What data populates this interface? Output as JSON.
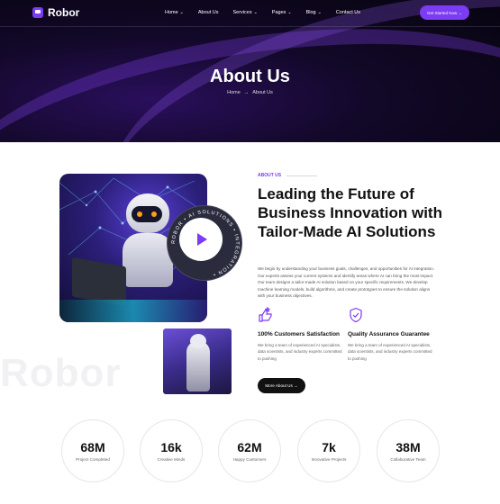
{
  "brand": {
    "name": "Robor",
    "accent": "#7b3cf3"
  },
  "nav": {
    "items": [
      {
        "label": "Home",
        "dropdown": true
      },
      {
        "label": "About Us",
        "dropdown": false
      },
      {
        "label": "Services",
        "dropdown": true
      },
      {
        "label": "Pages",
        "dropdown": true
      },
      {
        "label": "Blog",
        "dropdown": true
      },
      {
        "label": "Contact Us",
        "dropdown": false
      }
    ],
    "cta_label": "Get Started Now →"
  },
  "hero": {
    "title": "About Us",
    "breadcrumb": {
      "home": "Home",
      "separator": "→",
      "current": "About Us"
    }
  },
  "about": {
    "tag": "ABOUT US",
    "title": "Leading the Future of Business Innovation with Tailor-Made AI Solutions",
    "description": "We begin by understanding your business goals, challenges, and opportunities for AI integration. Our experts assess your current systems and identify areas where AI can bring the most impact. Our team designs a tailor-made AI solution based on your specific requirements. We develop machine learning models, build algorithms, and create prototypes to ensure the solution aligns with your business objectives.",
    "ring_text": "ROBOR • AI SOLUTIONS • INTEGRATION •",
    "watermark": "Robor",
    "features": [
      {
        "icon": "thumbs-up-icon",
        "title": "100% Customers Satisfaction",
        "desc": "We bring a team of experienced AI specialists, data scientists, and industry experts committed to pushing"
      },
      {
        "icon": "shield-check-icon",
        "title": "Quality Assurance Guarantee",
        "desc": "We bring a team of experienced AI specialists, data scientists, and industry experts committed to pushing"
      }
    ],
    "button_label": "More About Us →"
  },
  "stats": [
    {
      "value": "68M",
      "label": "Project Completed"
    },
    {
      "value": "16k",
      "label": "Creative Minds"
    },
    {
      "value": "62M",
      "label": "Happy Customers"
    },
    {
      "value": "7k",
      "label": "Innovative Projects"
    },
    {
      "value": "38M",
      "label": "Collaborative Team"
    }
  ]
}
